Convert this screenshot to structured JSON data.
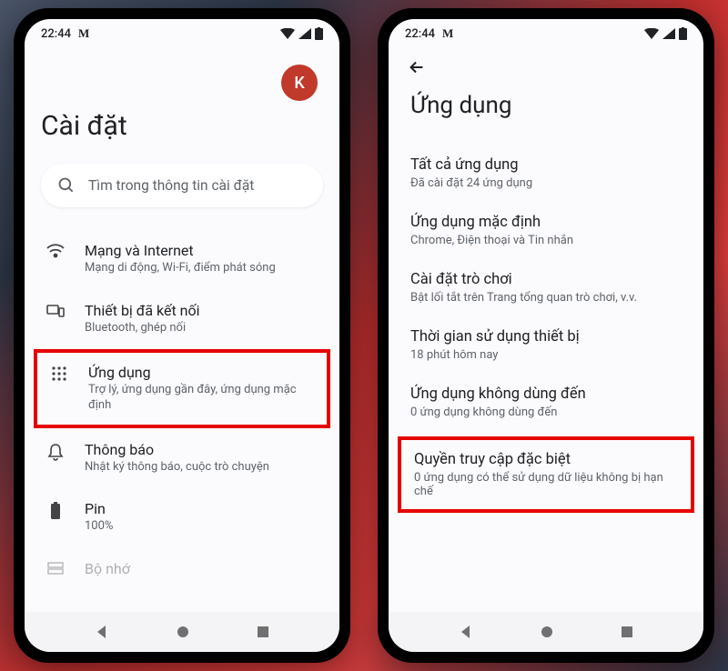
{
  "status": {
    "time": "22:44",
    "gmail_icon": "M"
  },
  "phone1": {
    "avatar": "K",
    "title": "Cài đặt",
    "search_placeholder": "Tìm trong thông tin cài đặt",
    "items": [
      {
        "title": "Mạng và Internet",
        "sub": "Mạng di động, Wi-Fi, điểm phát sóng"
      },
      {
        "title": "Thiết bị đã kết nối",
        "sub": "Bluetooth, ghép nối"
      },
      {
        "title": "Ứng dụng",
        "sub": "Trợ lý, ứng dụng gần đây, ứng dụng mặc định"
      },
      {
        "title": "Thông báo",
        "sub": "Nhật ký thông báo, cuộc trò chuyện"
      },
      {
        "title": "Pin",
        "sub": "100%"
      },
      {
        "title": "Bộ nhớ",
        "sub": ""
      }
    ]
  },
  "phone2": {
    "title": "Ứng dụng",
    "items": [
      {
        "title": "Tất cả ứng dụng",
        "sub": "Đã cài đặt 24 ứng dụng"
      },
      {
        "title": "Ứng dụng mặc định",
        "sub": "Chrome, Điện thoại và Tin nhắn"
      },
      {
        "title": "Cài đặt trò chơi",
        "sub": "Bật lối tắt trên Trang tổng quan trò chơi, v.v."
      },
      {
        "title": "Thời gian sử dụng thiết bị",
        "sub": "18 phút hôm nay"
      },
      {
        "title": "Ứng dụng không dùng đến",
        "sub": "0 ứng dụng không dùng đến"
      },
      {
        "title": "Quyền truy cập đặc biệt",
        "sub": "0 ứng dụng có thể sử dụng dữ liệu không bị hạn chế"
      }
    ]
  }
}
